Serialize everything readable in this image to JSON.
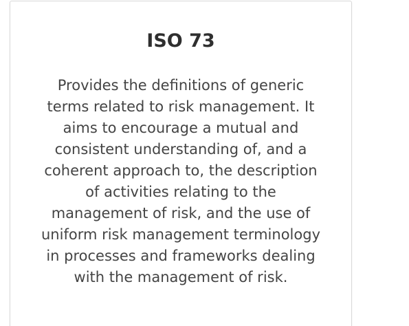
{
  "card": {
    "title": "ISO 73",
    "description": "Provides the definitions of generic terms related to risk management. It aims to encourage a mutual and consistent understanding of, and a coherent approach to, the description of activities relating to the management of risk, and the use of uniform risk management terminology in processes and frameworks dealing with the management of risk."
  }
}
